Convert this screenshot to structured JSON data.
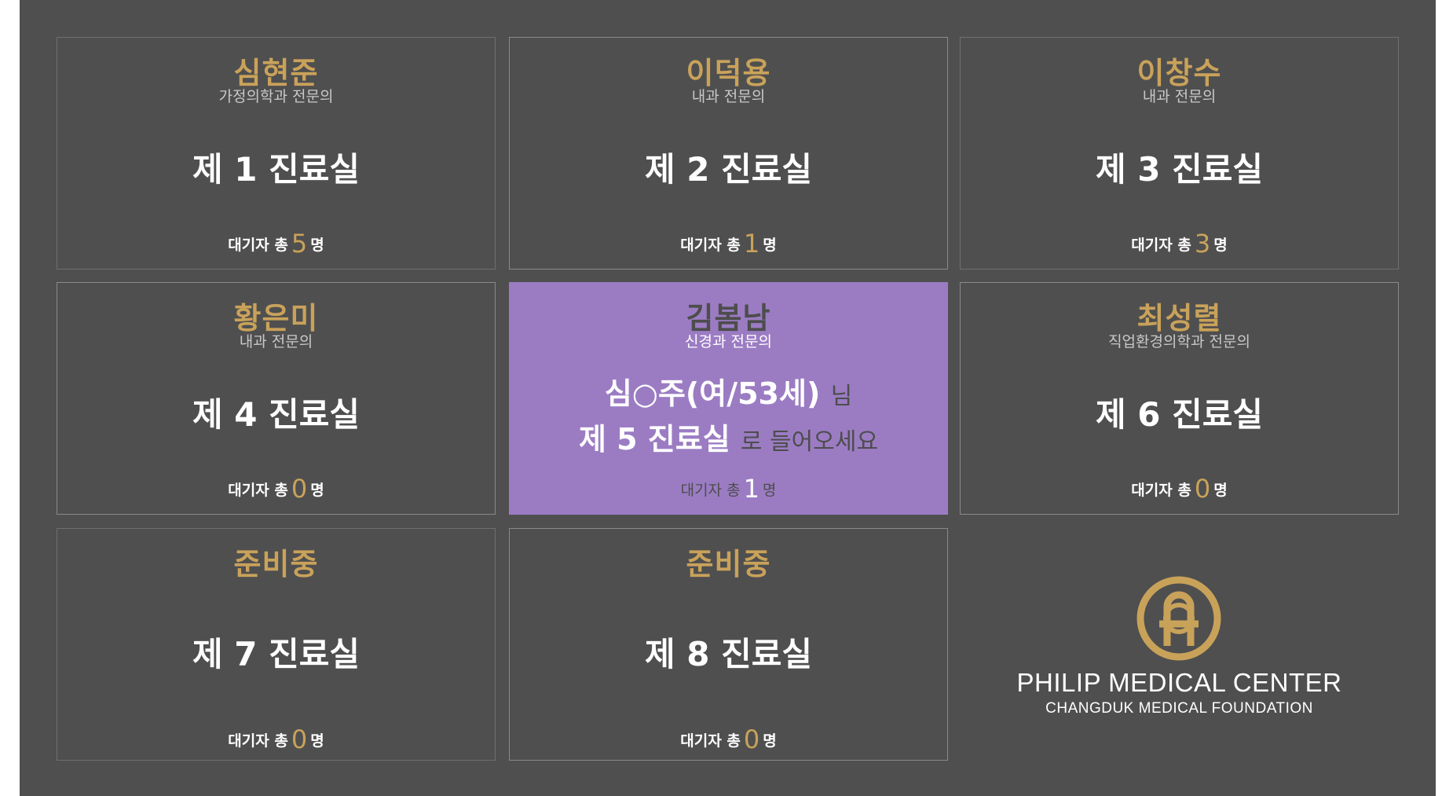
{
  "waiting_prefix": "대기자 총",
  "waiting_suffix": "명",
  "rooms": [
    {
      "doctor": "심현준",
      "specialty": "가정의학과 전문의",
      "room": "제 1 진료실",
      "waiting": "5"
    },
    {
      "doctor": "이덕용",
      "specialty": "내과 전문의",
      "room": "제 2 진료실",
      "waiting": "1"
    },
    {
      "doctor": "이창수",
      "specialty": "내과 전문의",
      "room": "제 3 진료실",
      "waiting": "3"
    },
    {
      "doctor": "황은미",
      "specialty": "내과 전문의",
      "room": "제 4 진료실",
      "waiting": "0"
    },
    {
      "doctor": "김봄남",
      "specialty": "신경과 전문의",
      "room": "제 5 진료실",
      "waiting": "1",
      "active": true,
      "patient": "심○주(여/53세)",
      "honorific": "님",
      "enter_text": "로 들어오세요"
    },
    {
      "doctor": "최성렬",
      "specialty": "직업환경의학과 전문의",
      "room": "제 6 진료실",
      "waiting": "0"
    },
    {
      "doctor": "준비중",
      "specialty": "",
      "room": "제 7 진료실",
      "waiting": "0"
    },
    {
      "doctor": "준비중",
      "specialty": "",
      "room": "제 8 진료실",
      "waiting": "0"
    }
  ],
  "logo": {
    "name": "PHILIP MEDICAL CENTER",
    "subtitle": "CHANGDUK MEDICAL FOUNDATION",
    "color": "#c9a25a",
    "icon": "philip-logo-emblem"
  },
  "colors": {
    "background": "#4f4f4f",
    "accent_gold": "#c9a25a",
    "active_purple": "#9b7cc3"
  }
}
